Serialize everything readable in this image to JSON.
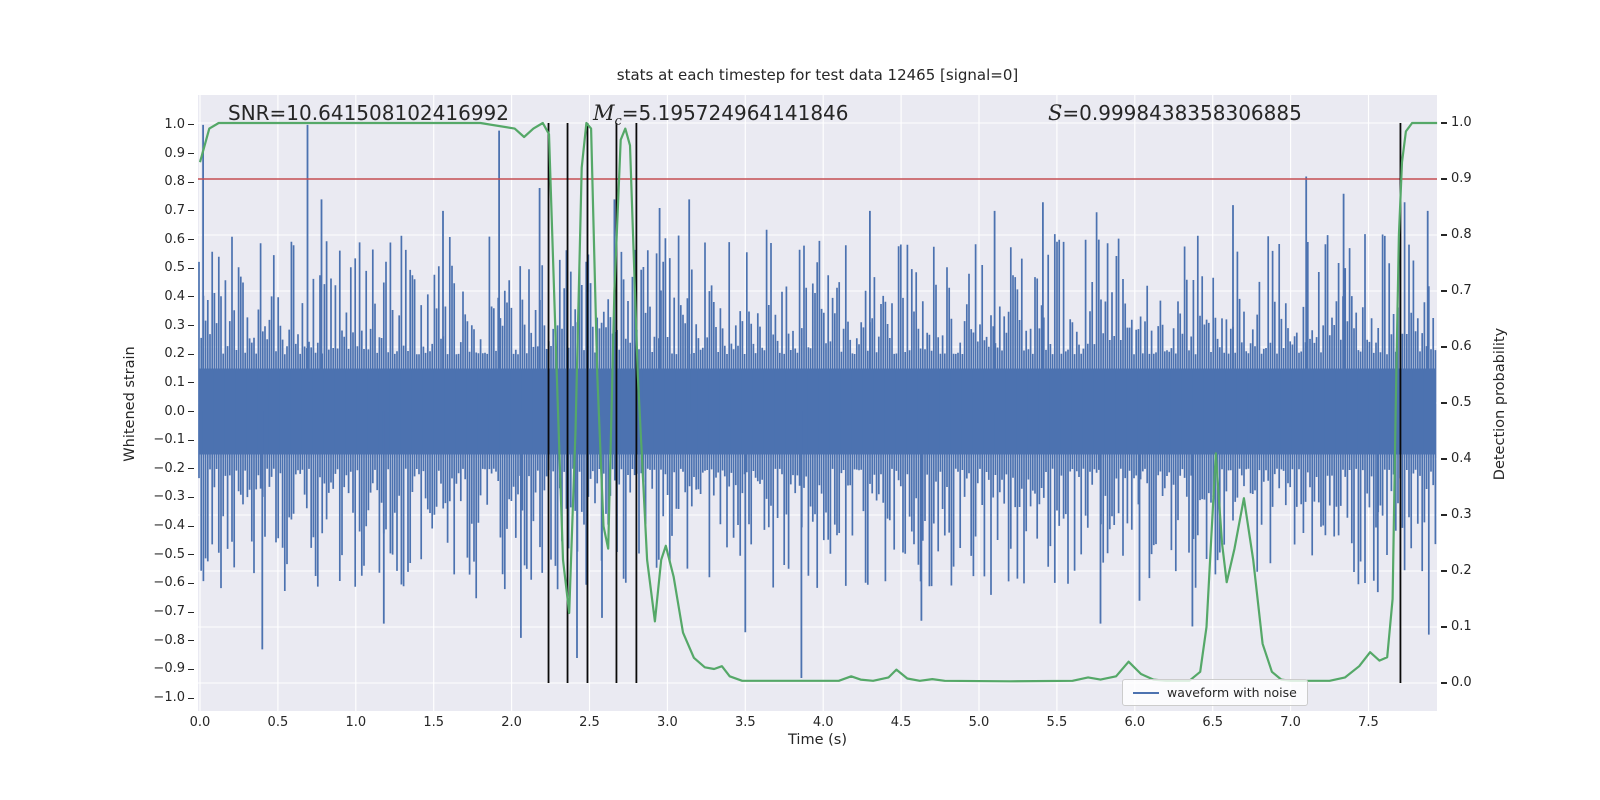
{
  "chart_data": {
    "type": "line",
    "title": "stats at each timestep for test data 12465 [signal=0]",
    "xlabel": "Time (s)",
    "ylabel_left": "Whitened strain",
    "ylabel_right": "Detection probability",
    "xlim": [
      0,
      7.94
    ],
    "ylim_left": [
      -1.08,
      1.08
    ],
    "ylim_right": [
      -0.05,
      1.05
    ],
    "x_ticks": [
      0.0,
      0.5,
      1.0,
      1.5,
      2.0,
      2.5,
      3.0,
      3.5,
      4.0,
      4.5,
      5.0,
      5.5,
      6.0,
      6.5,
      7.0,
      7.5
    ],
    "x_tick_labels": [
      "0.0",
      "0.5",
      "1.0",
      "1.5",
      "2.0",
      "2.5",
      "3.0",
      "3.5",
      "4.0",
      "4.5",
      "5.0",
      "5.5",
      "6.0",
      "6.5",
      "7.0",
      "7.5"
    ],
    "left_ticks": [
      1.0,
      0.9,
      0.8,
      0.7,
      0.6,
      0.5,
      0.4,
      0.3,
      0.2,
      0.1,
      0.0,
      -0.1,
      -0.2,
      -0.3,
      -0.4,
      -0.5,
      -0.6,
      -0.7,
      -0.8,
      -0.9,
      -1.0
    ],
    "left_tick_labels": [
      "1.0",
      "0.9",
      "0.8",
      "0.7",
      "0.6",
      "0.5",
      "0.4",
      "0.3",
      "0.2",
      "0.1",
      "0.0",
      "−0.1",
      "−0.2",
      "−0.3",
      "−0.4",
      "−0.5",
      "−0.6",
      "−0.7",
      "−0.8",
      "−0.9",
      "−1.0"
    ],
    "right_ticks": [
      1.0,
      0.9,
      0.8,
      0.7,
      0.6,
      0.5,
      0.4,
      0.3,
      0.2,
      0.1,
      0.0
    ],
    "right_tick_labels": [
      "1.0",
      "0.9",
      "0.8",
      "0.7",
      "0.6",
      "0.5",
      "0.4",
      "0.3",
      "0.2",
      "0.1",
      "0.0"
    ],
    "grid": {
      "color": "#ffffff",
      "x_interval_s": 0.5,
      "y_axis": "right",
      "y_interval": 0.1
    },
    "background": "#EAEAF2",
    "hline": {
      "axis": "right",
      "value": 0.9,
      "color": "#C44E52"
    },
    "vlines": {
      "color": "#0a0a0a",
      "span_right_axis": [
        0.0,
        1.0
      ],
      "times": [
        2.237,
        2.359,
        2.487,
        2.673,
        2.801,
        7.705
      ]
    },
    "annotations": [
      {
        "text": "SNR=10.641508102416992"
      },
      {
        "prefix": "M",
        "sub": "c",
        "value": "=5.195724964141846"
      },
      {
        "prefix": "S",
        "sub": "",
        "value": "=0.9998438358306885"
      }
    ],
    "legend": {
      "label": "waveform with noise",
      "color": "#4C72B0",
      "position": "lower right"
    },
    "series": [
      {
        "name": "waveform with noise",
        "type": "noise_band",
        "axis": "left",
        "color": "#4C72B0",
        "seed": 12465,
        "core_half_band": 0.15,
        "base_extent": 0.2,
        "var_extent": 0.42,
        "spike_prob": 0.05,
        "spike_extra": 0.18,
        "notable_spikes": [
          [
            0.02,
            1.0
          ],
          [
            0.4,
            -0.83
          ],
          [
            0.69,
            1.0
          ],
          [
            0.78,
            0.74
          ],
          [
            1.18,
            -0.74
          ],
          [
            1.56,
            0.7
          ],
          [
            1.92,
            0.98
          ],
          [
            2.06,
            -0.79
          ],
          [
            2.18,
            0.78
          ],
          [
            2.42,
            -0.86
          ],
          [
            2.58,
            -0.72
          ],
          [
            2.66,
            0.74
          ],
          [
            2.95,
            0.71
          ],
          [
            3.14,
            0.74
          ],
          [
            3.5,
            -0.77
          ],
          [
            3.86,
            -0.93
          ],
          [
            4.3,
            0.7
          ],
          [
            4.63,
            -0.73
          ],
          [
            5.1,
            0.7
          ],
          [
            5.41,
            0.73
          ],
          [
            5.78,
            -0.74
          ],
          [
            6.03,
            -0.66
          ],
          [
            6.37,
            -0.75
          ],
          [
            6.63,
            0.72
          ],
          [
            7.1,
            0.82
          ],
          [
            7.34,
            0.76
          ],
          [
            7.56,
            -0.63
          ],
          [
            7.88,
            0.7
          ]
        ]
      },
      {
        "name": "detection probability",
        "type": "line",
        "axis": "right",
        "color": "#55A868",
        "points": [
          [
            0.0,
            0.93
          ],
          [
            0.06,
            0.99
          ],
          [
            0.12,
            1.0
          ],
          [
            1.8,
            1.0
          ],
          [
            2.02,
            0.99
          ],
          [
            2.08,
            0.975
          ],
          [
            2.14,
            0.99
          ],
          [
            2.2,
            1.0
          ],
          [
            2.24,
            0.98
          ],
          [
            2.29,
            0.55
          ],
          [
            2.33,
            0.22
          ],
          [
            2.37,
            0.125
          ],
          [
            2.41,
            0.45
          ],
          [
            2.45,
            0.92
          ],
          [
            2.48,
            1.0
          ],
          [
            2.51,
            0.99
          ],
          [
            2.55,
            0.55
          ],
          [
            2.59,
            0.28
          ],
          [
            2.62,
            0.24
          ],
          [
            2.66,
            0.7
          ],
          [
            2.7,
            0.97
          ],
          [
            2.73,
            0.99
          ],
          [
            2.76,
            0.96
          ],
          [
            2.81,
            0.55
          ],
          [
            2.87,
            0.22
          ],
          [
            2.92,
            0.11
          ],
          [
            2.96,
            0.22
          ],
          [
            2.99,
            0.245
          ],
          [
            3.04,
            0.19
          ],
          [
            3.1,
            0.09
          ],
          [
            3.17,
            0.045
          ],
          [
            3.24,
            0.028
          ],
          [
            3.3,
            0.025
          ],
          [
            3.35,
            0.03
          ],
          [
            3.4,
            0.012
          ],
          [
            3.48,
            0.004
          ],
          [
            4.1,
            0.004
          ],
          [
            4.18,
            0.012
          ],
          [
            4.24,
            0.006
          ],
          [
            4.32,
            0.004
          ],
          [
            4.42,
            0.01
          ],
          [
            4.47,
            0.024
          ],
          [
            4.54,
            0.008
          ],
          [
            4.62,
            0.004
          ],
          [
            4.7,
            0.007
          ],
          [
            4.78,
            0.004
          ],
          [
            5.2,
            0.003
          ],
          [
            5.6,
            0.004
          ],
          [
            5.7,
            0.01
          ],
          [
            5.78,
            0.006
          ],
          [
            5.88,
            0.012
          ],
          [
            5.96,
            0.038
          ],
          [
            6.04,
            0.016
          ],
          [
            6.12,
            0.006
          ],
          [
            6.2,
            0.004
          ],
          [
            6.35,
            0.004
          ],
          [
            6.42,
            0.02
          ],
          [
            6.46,
            0.1
          ],
          [
            6.52,
            0.41
          ],
          [
            6.56,
            0.25
          ],
          [
            6.59,
            0.18
          ],
          [
            6.64,
            0.24
          ],
          [
            6.7,
            0.33
          ],
          [
            6.76,
            0.22
          ],
          [
            6.82,
            0.07
          ],
          [
            6.88,
            0.02
          ],
          [
            6.94,
            0.006
          ],
          [
            7.0,
            0.004
          ],
          [
            7.25,
            0.004
          ],
          [
            7.35,
            0.01
          ],
          [
            7.44,
            0.03
          ],
          [
            7.51,
            0.055
          ],
          [
            7.57,
            0.04
          ],
          [
            7.62,
            0.046
          ],
          [
            7.655,
            0.15
          ],
          [
            7.675,
            0.5
          ],
          [
            7.695,
            0.8
          ],
          [
            7.715,
            0.93
          ],
          [
            7.74,
            0.985
          ],
          [
            7.78,
            1.0
          ],
          [
            7.94,
            1.0
          ]
        ]
      }
    ]
  }
}
